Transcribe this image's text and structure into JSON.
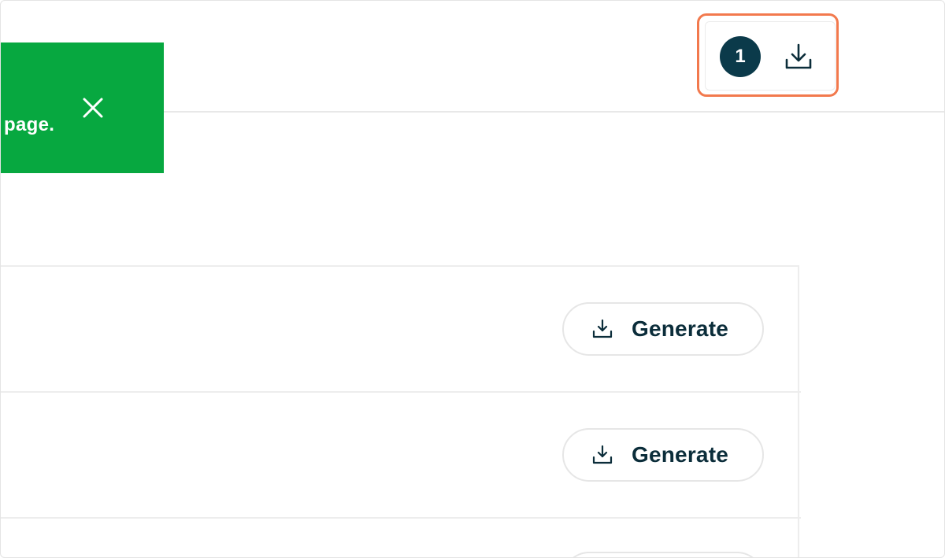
{
  "header": {
    "downloads": {
      "count": "1",
      "icon": "download-icon"
    },
    "highlight_color": "#f2794d"
  },
  "toast": {
    "message": "page.",
    "close_icon": "close-icon",
    "background": "#07a840"
  },
  "rows": [
    {
      "button_label": "Generate",
      "button_icon": "download-icon"
    },
    {
      "button_label": "Generate",
      "button_icon": "download-icon"
    }
  ],
  "colors": {
    "badge": "#0b3a4a",
    "button_text": "#0b2d3a"
  }
}
